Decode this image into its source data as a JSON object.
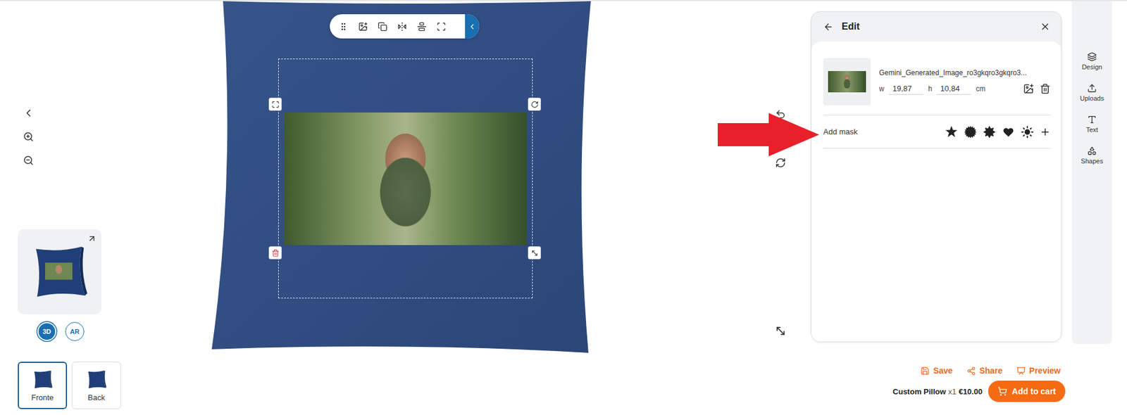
{
  "editor": {
    "view_modes": [
      {
        "label": "3D",
        "selected": true
      },
      {
        "label": "AR",
        "selected": false
      }
    ],
    "side_tabs": [
      {
        "label": "Fronte",
        "selected": true
      },
      {
        "label": "Back",
        "selected": false
      }
    ]
  },
  "edit_panel": {
    "title": "Edit",
    "image": {
      "name": "Gemini_Generated_Image_ro3gkqro3gkqro3...",
      "width_label": "w",
      "width": "19,87",
      "height_label": "h",
      "height": "10,84",
      "unit": "cm"
    },
    "mask": {
      "label": "Add mask"
    }
  },
  "sidebar": {
    "items": [
      {
        "label": "Design",
        "selected": false
      },
      {
        "label": "Uploads",
        "selected": false
      },
      {
        "label": "Text",
        "selected": false
      },
      {
        "label": "Shapes",
        "selected": false
      }
    ]
  },
  "actions": [
    {
      "label": "Save"
    },
    {
      "label": "Share"
    },
    {
      "label": "Preview"
    }
  ],
  "cart": {
    "product": "Custom Pillow",
    "quantity": "x1",
    "price": "€10.00",
    "button": "Add to cart"
  }
}
